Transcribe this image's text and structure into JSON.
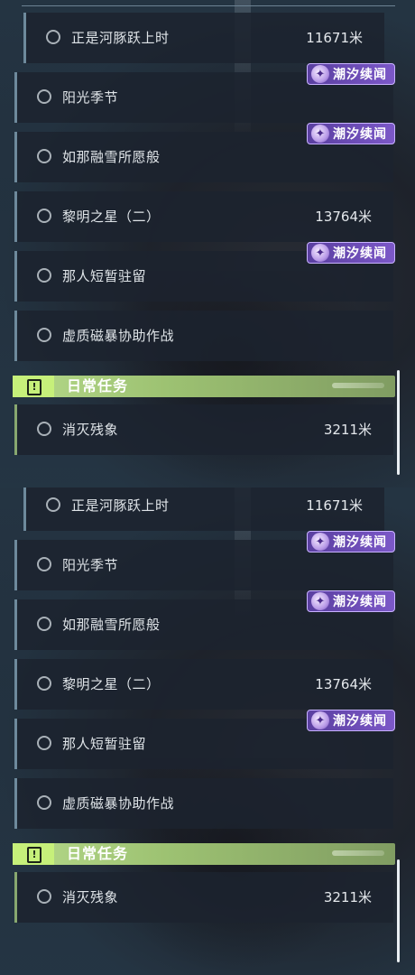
{
  "panels": [
    {
      "quests": [
        {
          "label": "正是河豚跃上时",
          "distance": "11671米"
        },
        {
          "label": "阳光季节",
          "distance": ""
        },
        {
          "label": "如那融雪所愿般",
          "distance": ""
        },
        {
          "label": "黎明之星（二）",
          "distance": "13764米"
        },
        {
          "label": "那人短暂驻留",
          "distance": ""
        },
        {
          "label": "虚质磁暴协助作战",
          "distance": ""
        }
      ],
      "tags": [
        "潮汐续闻",
        "潮汐续闻",
        "潮汐续闻"
      ],
      "daily": {
        "title": "日常任务",
        "quest": {
          "label": "消灭残象",
          "distance": "3211米"
        }
      }
    },
    {
      "quests": [
        {
          "label": "正是河豚跃上时",
          "distance": "11671米"
        },
        {
          "label": "阳光季节",
          "distance": ""
        },
        {
          "label": "如那融雪所愿般",
          "distance": ""
        },
        {
          "label": "黎明之星（二）",
          "distance": "13764米"
        },
        {
          "label": "那人短暂驻留",
          "distance": ""
        },
        {
          "label": "虚质磁暴协助作战",
          "distance": ""
        }
      ],
      "tags": [
        "潮汐续闻",
        "潮汐续闻",
        "潮汐续闻"
      ],
      "daily": {
        "title": "日常任务",
        "quest": {
          "label": "消灭残象",
          "distance": "3211米"
        }
      }
    }
  ],
  "icons": {
    "tag": "tidal-tale-icon",
    "section": "exclamation-icon",
    "radio": "radio-ring-icon"
  },
  "colors": {
    "tag_bg": "#6b4bb8",
    "section_bg": "#a6c97a",
    "row_accent": "#6e8a9c"
  }
}
